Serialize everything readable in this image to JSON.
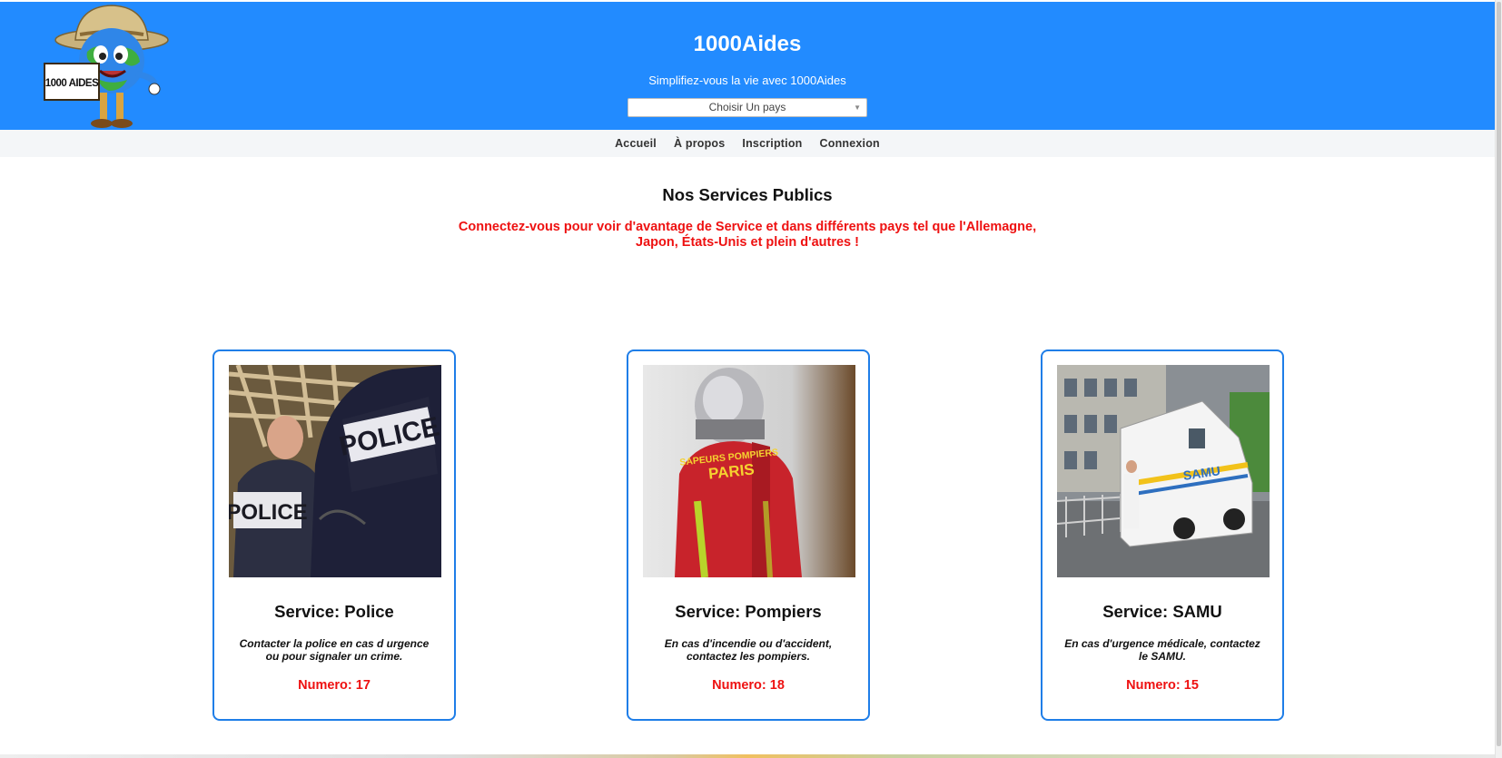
{
  "header": {
    "site_title": "1000Aides",
    "tagline": "Simplifiez-vous la vie avec 1000Aides",
    "logo_sign_text": "1000 AIDES",
    "country_select": {
      "selected": "Choisir Un pays"
    },
    "bg_color": "#228bff"
  },
  "nav": {
    "items": [
      {
        "label": "Accueil"
      },
      {
        "label": "À propos"
      },
      {
        "label": "Inscription"
      },
      {
        "label": "Connexion"
      }
    ]
  },
  "main": {
    "section_title": "Nos Services Publics",
    "notice_line1": "Connectez-vous pour voir d'avantage de Service et dans différents pays tel que l'Allemagne,",
    "notice_line2": "Japon, États-Unis et plein d'autres !",
    "notice_color": "#ee1111"
  },
  "services": [
    {
      "title": "Service: Police",
      "desc_line1": "Contacter la police en cas d urgence",
      "desc_line2": "ou pour signaler un crime.",
      "number": "Numero: 17",
      "photo_text": "POLICE"
    },
    {
      "title": "Service: Pompiers",
      "desc_line1": "En cas d'incendie ou d'accident,",
      "desc_line2": "contactez les pompiers.",
      "number": "Numero: 18",
      "photo_text_1": "SAPEURS POMPIERS",
      "photo_text_2": "PARIS"
    },
    {
      "title": "Service: SAMU",
      "desc_line1": "En cas d'urgence médicale, contactez",
      "desc_line2": "le SAMU.",
      "number": "Numero: 15",
      "photo_text": "SAMU"
    }
  ],
  "colors": {
    "card_border": "#1f7ee8",
    "number": "#ee1111"
  }
}
